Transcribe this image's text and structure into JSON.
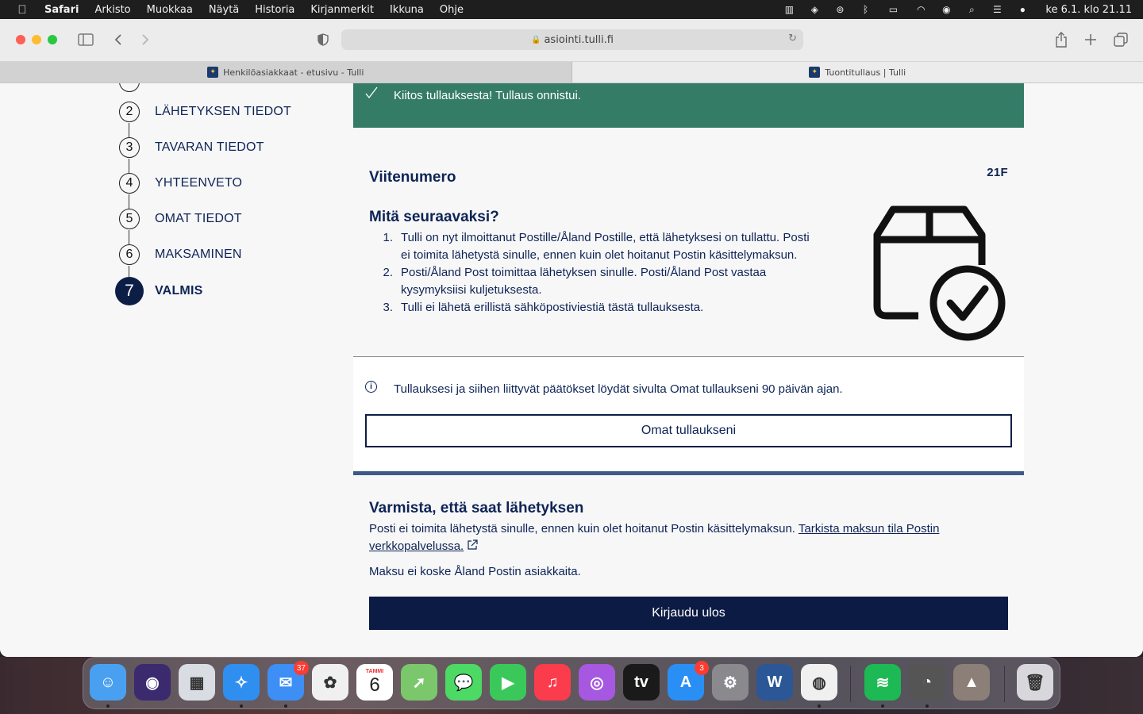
{
  "menubar": {
    "app_name": "Safari",
    "items": [
      "Arkisto",
      "Muokkaa",
      "Näytä",
      "Historia",
      "Kirjanmerkit",
      "Ikkuna",
      "Ohje"
    ],
    "clock": "ke 6.1. klo  21.11",
    "status_icons": [
      "stage-manager-icon",
      "dropbox-icon",
      "airplay-icon",
      "bluetooth-icon",
      "battery-icon",
      "wifi-icon",
      "user-icon",
      "spotlight-icon",
      "control-center-icon",
      "siri-icon"
    ]
  },
  "browser": {
    "url": "asiointi.tulli.fi",
    "tabs": [
      {
        "title": "Henkilöasiakkaat - etusivu - Tulli",
        "active": false
      },
      {
        "title": "Tuontitullaus | Tulli",
        "active": true
      }
    ]
  },
  "stepper": {
    "steps": [
      {
        "number": "2",
        "label": "LÄHETYKSEN TIEDOT"
      },
      {
        "number": "3",
        "label": "TAVARAN TIEDOT"
      },
      {
        "number": "4",
        "label": "YHTEENVETO"
      },
      {
        "number": "5",
        "label": "OMAT TIEDOT"
      },
      {
        "number": "6",
        "label": "MAKSAMINEN"
      },
      {
        "number": "7",
        "label": "VALMIS",
        "current": true
      }
    ]
  },
  "success": {
    "message": "Kiitos tullauksesta! Tullaus onnistui."
  },
  "reference": {
    "label": "Viitenumero",
    "value": "21F"
  },
  "next_steps": {
    "title": "Mitä seuraavaksi?",
    "items": [
      {
        "number": "1.",
        "lines": [
          "Tulli on nyt ilmoittanut Postille/Åland Postille, että lähetyksesi on tullattu. Posti",
          "ei toimita lähetystä sinulle, ennen kuin olet hoitanut Postin käsittelymaksun."
        ]
      },
      {
        "number": "2.",
        "lines": [
          "Posti/Åland Post toimittaa lähetyksen sinulle. Posti/Åland Post vastaa",
          "kysymyksiisi kuljetuksesta."
        ]
      },
      {
        "number": "3.",
        "lines": [
          "Tulli ei lähetä erillistä sähköpostiviestiä tästä tullauksesta."
        ]
      }
    ]
  },
  "info": {
    "text": "Tullauksesi ja siihen liittyvät päätökset löydät sivulta Omat tullaukseni 90 päivän ajan.",
    "button_label": "Omat tullaukseni"
  },
  "verify": {
    "title": "Varmista, että saat lähetyksen",
    "text": "Posti ei toimita lähetystä sinulle, ennen kuin olet hoitanut Postin käsittelymaksun.",
    "link_line1": "Tarkista maksun tila Postin",
    "link_line2": "verkkopalvelussa.",
    "aland_note": "Maksu ei koske Åland Postin asiakkaita.",
    "logout_label": "Kirjaudu ulos"
  },
  "dock": {
    "apps": [
      {
        "name": "finder-icon",
        "color": "#4aa0f0",
        "glyph": "☺",
        "running": true
      },
      {
        "name": "siri-icon",
        "color": "#3b2a6e",
        "glyph": "◉",
        "running": false
      },
      {
        "name": "launchpad-icon",
        "color": "#d9dde3",
        "glyph": "▦",
        "running": false
      },
      {
        "name": "safari-icon",
        "color": "#2f8ff0",
        "glyph": "✧",
        "running": true
      },
      {
        "name": "mail-icon",
        "color": "#3d8ef5",
        "glyph": "✉",
        "running": true,
        "badge": "37"
      },
      {
        "name": "photos-icon",
        "color": "#f0f0f0",
        "glyph": "✿",
        "running": false
      },
      {
        "name": "calendar-icon",
        "color": "#ffffff",
        "glyph": "6",
        "running": false,
        "label": "TAMMI"
      },
      {
        "name": "maps-icon",
        "color": "#7ac86b",
        "glyph": "➚",
        "running": false
      },
      {
        "name": "messages-icon",
        "color": "#4cd964",
        "glyph": "💬",
        "running": false
      },
      {
        "name": "facetime-icon",
        "color": "#3ac85a",
        "glyph": "▶",
        "running": false
      },
      {
        "name": "music-icon",
        "color": "#fa3c4c",
        "glyph": "♫",
        "running": false
      },
      {
        "name": "podcasts-icon",
        "color": "#a658e0",
        "glyph": "◎",
        "running": false
      },
      {
        "name": "apple-tv-icon",
        "color": "#1a1a1a",
        "glyph": "tv",
        "running": false
      },
      {
        "name": "app-store-icon",
        "color": "#2a8ff5",
        "glyph": "A",
        "running": false,
        "badge": "3"
      },
      {
        "name": "system-preferences-icon",
        "color": "#8a8a8e",
        "glyph": "⚙",
        "running": false
      },
      {
        "name": "word-icon",
        "color": "#2b5797",
        "glyph": "W",
        "running": false
      },
      {
        "name": "chrome-icon",
        "color": "#f0f0f0",
        "glyph": "◍",
        "running": true
      },
      {
        "name": "spotify-icon",
        "color": "#1db954",
        "glyph": "≋",
        "running": true
      },
      {
        "name": "activity-monitor-icon",
        "color": "#555",
        "glyph": "◔",
        "running": true
      },
      {
        "name": "downloads-stack-icon",
        "color": "#8c7f78",
        "glyph": "▲",
        "running": false
      },
      {
        "name": "trash-icon",
        "color": "#d8d8dc",
        "glyph": "🗑",
        "running": false
      }
    ]
  }
}
